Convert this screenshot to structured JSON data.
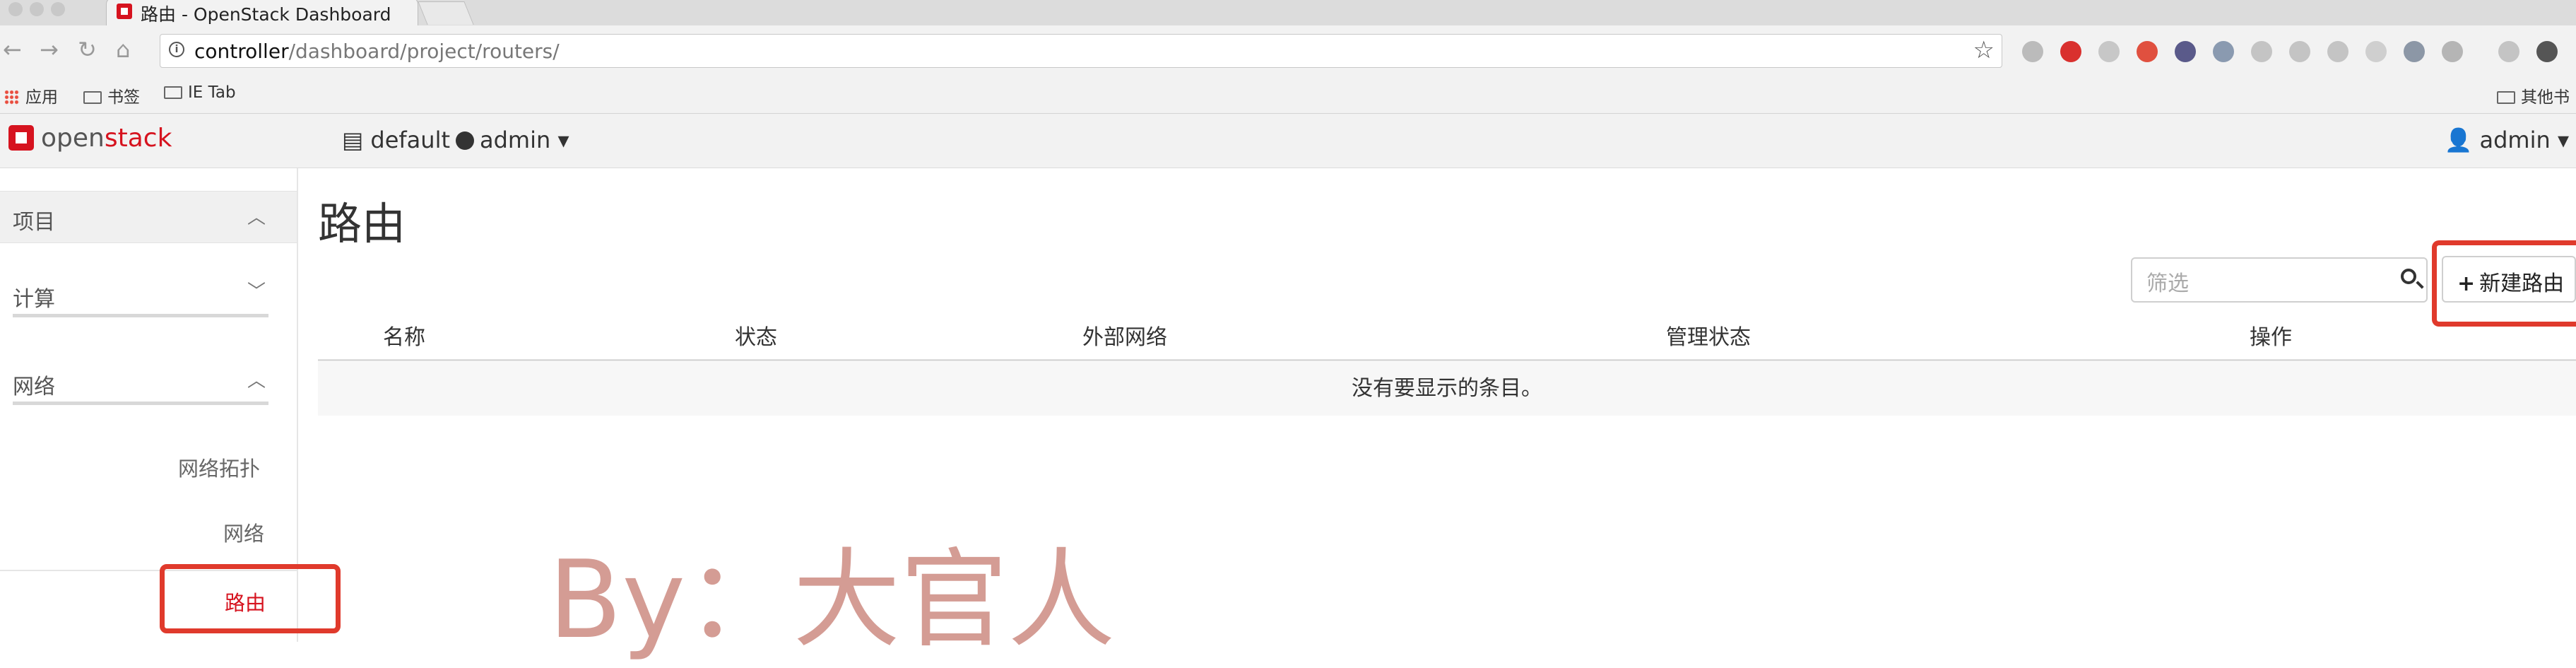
{
  "browser": {
    "tab_title": "路由 - OpenStack Dashboard",
    "url_host": "controller",
    "url_path": "/dashboard/project/routers/",
    "bookmarks": [
      "应用",
      "书签",
      "IE Tab"
    ],
    "other_bookmarks": "其他书"
  },
  "header": {
    "logo_prefix": "open",
    "logo_suffix": "stack",
    "project": "default",
    "project_user": "admin",
    "user": "admin"
  },
  "sidebar": {
    "project": "项目",
    "compute": "计算",
    "network": "网络",
    "items": [
      "网络拓扑",
      "网络",
      "路由"
    ]
  },
  "page": {
    "title": "路由",
    "filter_placeholder": "筛选",
    "create_button": "新建路由",
    "columns": [
      "名称",
      "状态",
      "外部网络",
      "管理状态",
      "操作"
    ],
    "empty_message": "没有要显示的条目。"
  },
  "watermark": "By：大官人",
  "colors": {
    "brand_red": "#d6131f",
    "highlight_red": "#e03a2c",
    "watermark": "#d49c94"
  }
}
